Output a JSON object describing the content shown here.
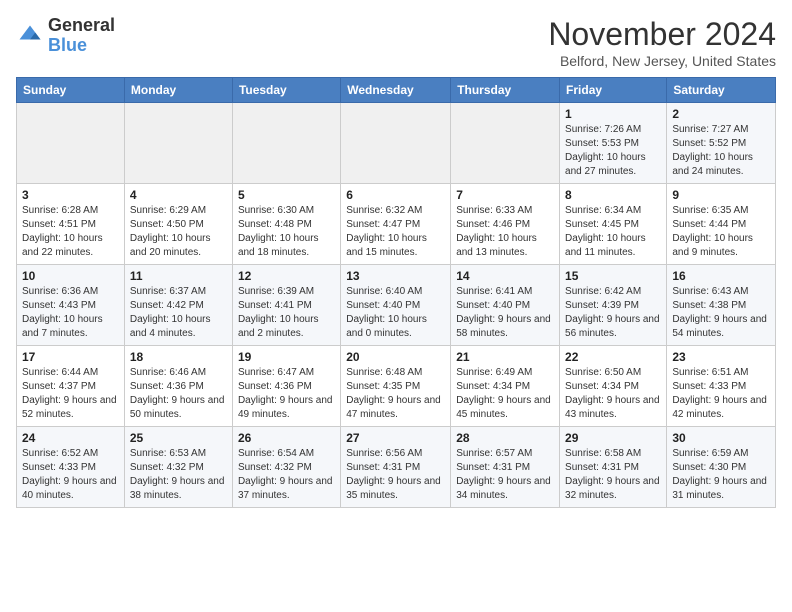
{
  "header": {
    "logo_general": "General",
    "logo_blue": "Blue",
    "month_title": "November 2024",
    "location": "Belford, New Jersey, United States"
  },
  "weekdays": [
    "Sunday",
    "Monday",
    "Tuesday",
    "Wednesday",
    "Thursday",
    "Friday",
    "Saturday"
  ],
  "weeks": [
    [
      {
        "day": "",
        "info": ""
      },
      {
        "day": "",
        "info": ""
      },
      {
        "day": "",
        "info": ""
      },
      {
        "day": "",
        "info": ""
      },
      {
        "day": "",
        "info": ""
      },
      {
        "day": "1",
        "info": "Sunrise: 7:26 AM\nSunset: 5:53 PM\nDaylight: 10 hours and 27 minutes."
      },
      {
        "day": "2",
        "info": "Sunrise: 7:27 AM\nSunset: 5:52 PM\nDaylight: 10 hours and 24 minutes."
      }
    ],
    [
      {
        "day": "3",
        "info": "Sunrise: 6:28 AM\nSunset: 4:51 PM\nDaylight: 10 hours and 22 minutes."
      },
      {
        "day": "4",
        "info": "Sunrise: 6:29 AM\nSunset: 4:50 PM\nDaylight: 10 hours and 20 minutes."
      },
      {
        "day": "5",
        "info": "Sunrise: 6:30 AM\nSunset: 4:48 PM\nDaylight: 10 hours and 18 minutes."
      },
      {
        "day": "6",
        "info": "Sunrise: 6:32 AM\nSunset: 4:47 PM\nDaylight: 10 hours and 15 minutes."
      },
      {
        "day": "7",
        "info": "Sunrise: 6:33 AM\nSunset: 4:46 PM\nDaylight: 10 hours and 13 minutes."
      },
      {
        "day": "8",
        "info": "Sunrise: 6:34 AM\nSunset: 4:45 PM\nDaylight: 10 hours and 11 minutes."
      },
      {
        "day": "9",
        "info": "Sunrise: 6:35 AM\nSunset: 4:44 PM\nDaylight: 10 hours and 9 minutes."
      }
    ],
    [
      {
        "day": "10",
        "info": "Sunrise: 6:36 AM\nSunset: 4:43 PM\nDaylight: 10 hours and 7 minutes."
      },
      {
        "day": "11",
        "info": "Sunrise: 6:37 AM\nSunset: 4:42 PM\nDaylight: 10 hours and 4 minutes."
      },
      {
        "day": "12",
        "info": "Sunrise: 6:39 AM\nSunset: 4:41 PM\nDaylight: 10 hours and 2 minutes."
      },
      {
        "day": "13",
        "info": "Sunrise: 6:40 AM\nSunset: 4:40 PM\nDaylight: 10 hours and 0 minutes."
      },
      {
        "day": "14",
        "info": "Sunrise: 6:41 AM\nSunset: 4:40 PM\nDaylight: 9 hours and 58 minutes."
      },
      {
        "day": "15",
        "info": "Sunrise: 6:42 AM\nSunset: 4:39 PM\nDaylight: 9 hours and 56 minutes."
      },
      {
        "day": "16",
        "info": "Sunrise: 6:43 AM\nSunset: 4:38 PM\nDaylight: 9 hours and 54 minutes."
      }
    ],
    [
      {
        "day": "17",
        "info": "Sunrise: 6:44 AM\nSunset: 4:37 PM\nDaylight: 9 hours and 52 minutes."
      },
      {
        "day": "18",
        "info": "Sunrise: 6:46 AM\nSunset: 4:36 PM\nDaylight: 9 hours and 50 minutes."
      },
      {
        "day": "19",
        "info": "Sunrise: 6:47 AM\nSunset: 4:36 PM\nDaylight: 9 hours and 49 minutes."
      },
      {
        "day": "20",
        "info": "Sunrise: 6:48 AM\nSunset: 4:35 PM\nDaylight: 9 hours and 47 minutes."
      },
      {
        "day": "21",
        "info": "Sunrise: 6:49 AM\nSunset: 4:34 PM\nDaylight: 9 hours and 45 minutes."
      },
      {
        "day": "22",
        "info": "Sunrise: 6:50 AM\nSunset: 4:34 PM\nDaylight: 9 hours and 43 minutes."
      },
      {
        "day": "23",
        "info": "Sunrise: 6:51 AM\nSunset: 4:33 PM\nDaylight: 9 hours and 42 minutes."
      }
    ],
    [
      {
        "day": "24",
        "info": "Sunrise: 6:52 AM\nSunset: 4:33 PM\nDaylight: 9 hours and 40 minutes."
      },
      {
        "day": "25",
        "info": "Sunrise: 6:53 AM\nSunset: 4:32 PM\nDaylight: 9 hours and 38 minutes."
      },
      {
        "day": "26",
        "info": "Sunrise: 6:54 AM\nSunset: 4:32 PM\nDaylight: 9 hours and 37 minutes."
      },
      {
        "day": "27",
        "info": "Sunrise: 6:56 AM\nSunset: 4:31 PM\nDaylight: 9 hours and 35 minutes."
      },
      {
        "day": "28",
        "info": "Sunrise: 6:57 AM\nSunset: 4:31 PM\nDaylight: 9 hours and 34 minutes."
      },
      {
        "day": "29",
        "info": "Sunrise: 6:58 AM\nSunset: 4:31 PM\nDaylight: 9 hours and 32 minutes."
      },
      {
        "day": "30",
        "info": "Sunrise: 6:59 AM\nSunset: 4:30 PM\nDaylight: 9 hours and 31 minutes."
      }
    ]
  ]
}
